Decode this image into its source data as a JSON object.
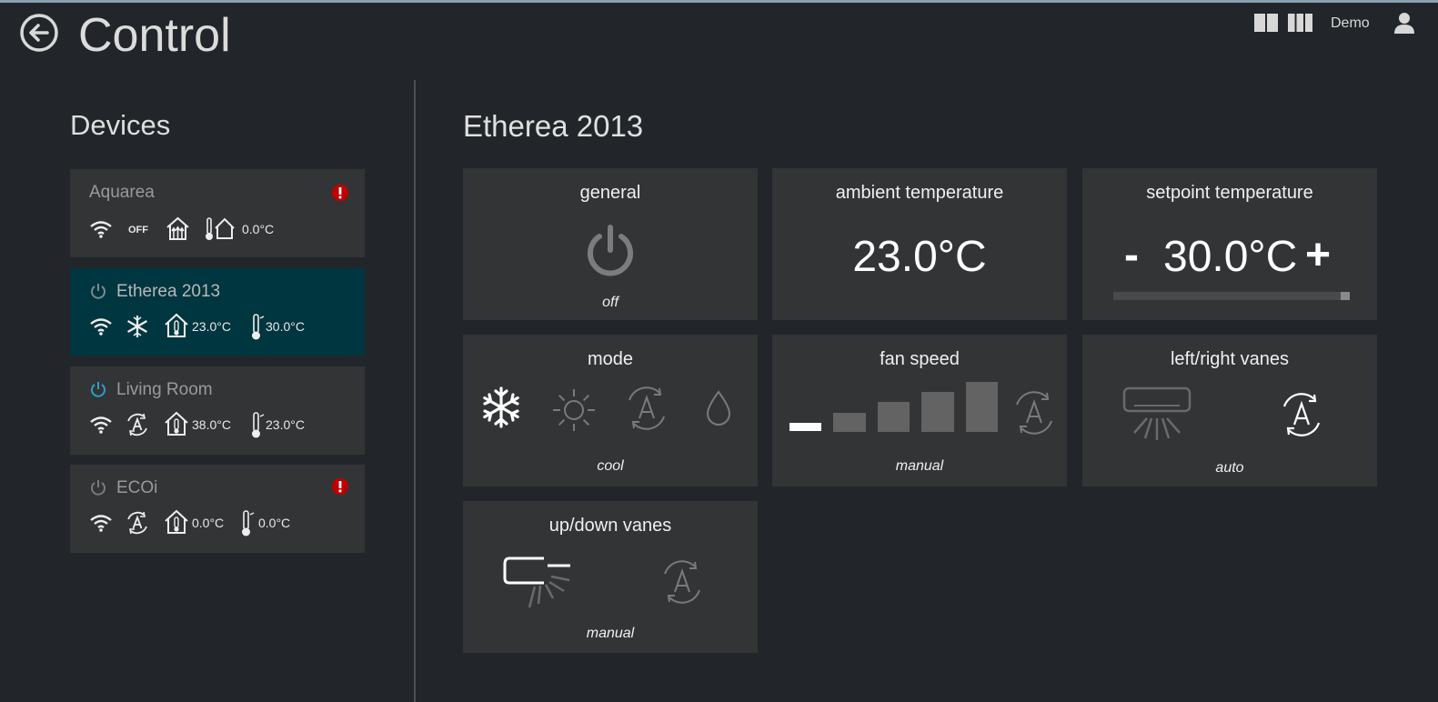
{
  "header": {
    "title": "Control",
    "user": "Demo"
  },
  "sidebar": {
    "title": "Devices",
    "devices": [
      {
        "name": "Aquarea",
        "status": "OFF",
        "alert": true,
        "ambient": "",
        "setpoint": "0.0°C"
      },
      {
        "name": "Etherea 2013",
        "mode": "cool",
        "alert": false,
        "ambient": "23.0°C",
        "setpoint": "30.0°C",
        "selected": true
      },
      {
        "name": "Living Room",
        "mode": "auto",
        "alert": false,
        "ambient": "38.0°C",
        "setpoint": "23.0°C",
        "power_color": "#2f9ec4"
      },
      {
        "name": "ECOi",
        "mode": "auto",
        "alert": true,
        "ambient": "0.0°C",
        "setpoint": "0.0°C"
      }
    ]
  },
  "main": {
    "title": "Etherea 2013",
    "tiles": {
      "general": {
        "title": "general",
        "value": "off"
      },
      "ambient": {
        "title": "ambient temperature",
        "value": "23.0°C"
      },
      "setpoint": {
        "title": "setpoint temperature",
        "value": "30.0°C",
        "minus": "-",
        "plus": "+"
      },
      "mode": {
        "title": "mode",
        "value": "cool",
        "options": [
          "cool",
          "heat",
          "auto",
          "dry"
        ],
        "selected": "cool"
      },
      "fan": {
        "title": "fan speed",
        "value": "manual",
        "levels": 5,
        "selected_level": 1
      },
      "lr_vanes": {
        "title": "left/right vanes",
        "value": "auto"
      },
      "ud_vanes": {
        "title": "up/down vanes",
        "value": "manual"
      }
    }
  },
  "colors": {
    "background": "#22262a",
    "tile": "#333435",
    "selected": "#003640",
    "alert": "#c00000",
    "accent": "#2f9ec4"
  }
}
